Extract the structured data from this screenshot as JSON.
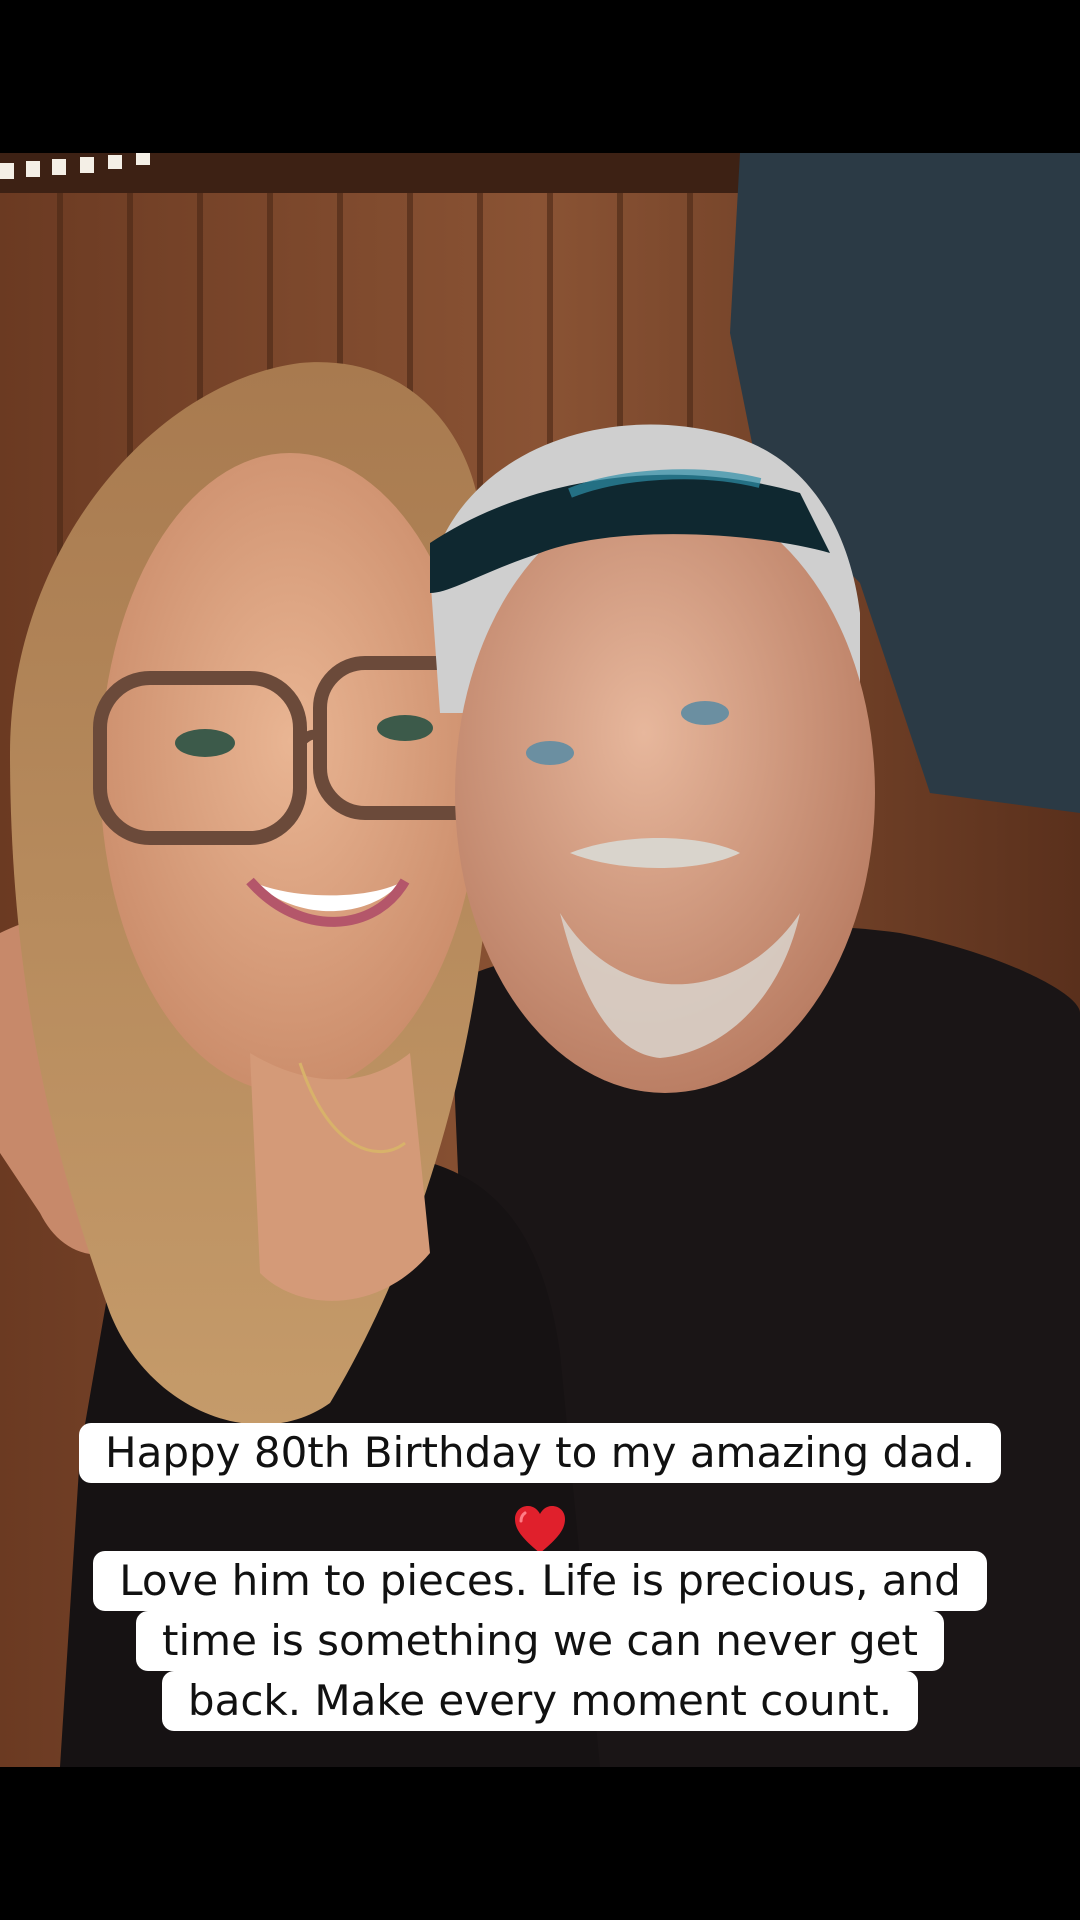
{
  "caption": {
    "line1": "Happy 80th Birthday to my amazing dad.",
    "heart": "red-heart-emoji",
    "line2": "Love him to pieces. Life is precious, and",
    "line3": "time is something we can never get",
    "line4": "back. Make every moment count."
  },
  "colors": {
    "background": "#000000",
    "caption_bg": "#ffffff",
    "caption_text": "#111111",
    "heart": "#e0202c"
  }
}
